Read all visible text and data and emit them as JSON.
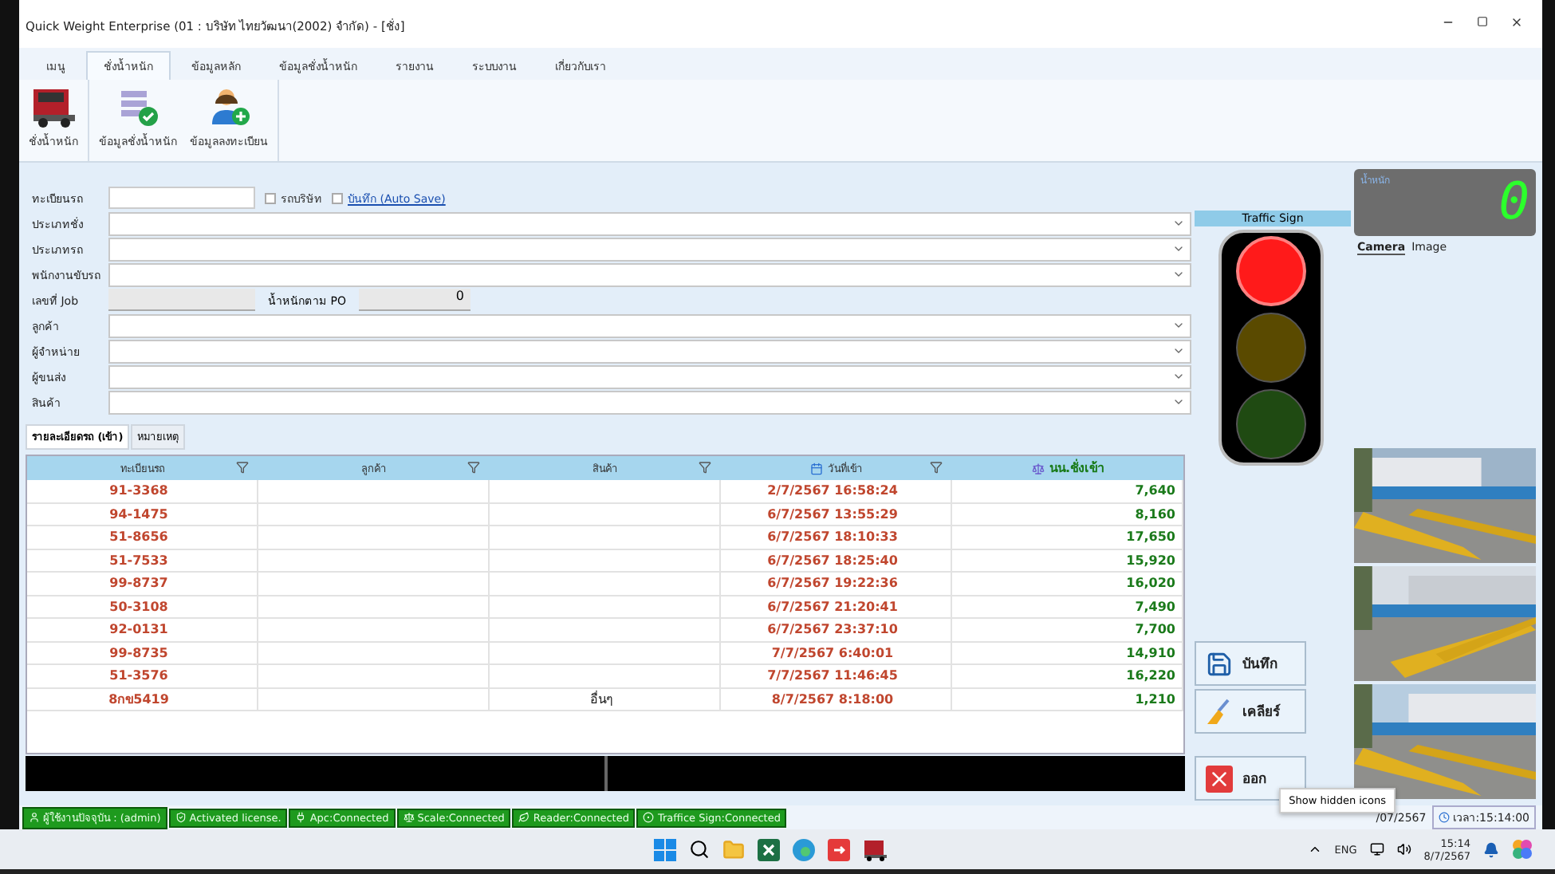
{
  "window": {
    "title": "Quick Weight Enterprise (01 : บริษัท ไทยวัฒนา(2002) จำกัด) - [ชั่ง]"
  },
  "menu_tabs": [
    {
      "label": "เมนู",
      "selected": false
    },
    {
      "label": "ชั่งน้ำหนัก",
      "selected": true
    },
    {
      "label": "ข้อมูลหลัก",
      "selected": false
    },
    {
      "label": "ข้อมูลชั่งน้ำหนัก",
      "selected": false
    },
    {
      "label": "รายงาน",
      "selected": false
    },
    {
      "label": "ระบบงาน",
      "selected": false
    },
    {
      "label": "เกี่ยวกับเรา",
      "selected": false
    }
  ],
  "ribbon": [
    {
      "label": "ชั่งน้ำหนัก",
      "kind": "truck"
    },
    {
      "label": "ข้อมูลชั่งน้ำหนัก",
      "kind": "list"
    },
    {
      "label": "ข้อมูลลงทะเบียน",
      "kind": "person"
    }
  ],
  "plate": {
    "label": "ทะเบียนรถ",
    "checkboxes": [
      {
        "label": "รถบริษัท",
        "checked": false,
        "kind": "plain"
      },
      {
        "label": "บันทึก (Auto Save)",
        "checked": false,
        "kind": "link"
      }
    ]
  },
  "fields": [
    {
      "label": "ประเภทชั่ง",
      "kind": "combo"
    },
    {
      "label": "ประเภทรถ",
      "kind": "combo"
    },
    {
      "label": "พนักงานขับรถ",
      "kind": "combo"
    },
    {
      "label": "เลขที่ Job",
      "kind": "job",
      "po_label": "น้ำหนักตาม PO",
      "po_value": "0"
    },
    {
      "label": "ลูกค้า",
      "kind": "combo"
    },
    {
      "label": "ผู้จำหน่าย",
      "kind": "combo"
    },
    {
      "label": "ผู้ขนส่ง",
      "kind": "combo"
    },
    {
      "label": "สินค้า",
      "kind": "combo"
    }
  ],
  "detail_tabs": [
    {
      "label": "รายละเอียดรถ (เข้า)",
      "selected": true
    },
    {
      "label": "หมายเหตุ",
      "selected": false
    }
  ],
  "table": {
    "columns": [
      {
        "label": "ทะเบียนรถ",
        "kind": "text",
        "filter": true
      },
      {
        "label": "ลูกค้า",
        "kind": "text",
        "filter": true
      },
      {
        "label": "สินค้า",
        "kind": "text",
        "filter": true
      },
      {
        "label": "วันที่เข้า",
        "kind": "date",
        "filter": true
      },
      {
        "label": "นน.ชั่งเข้า",
        "kind": "weight"
      }
    ],
    "rows": [
      [
        "91-3368",
        "",
        "",
        "2/7/2567 16:58:24",
        "7,640"
      ],
      [
        "94-1475",
        "",
        "",
        "6/7/2567 13:55:29",
        "8,160"
      ],
      [
        "51-8656",
        "",
        "",
        "6/7/2567 18:10:33",
        "17,650"
      ],
      [
        "51-7533",
        "",
        "",
        "6/7/2567 18:25:40",
        "15,920"
      ],
      [
        "99-8737",
        "",
        "",
        "6/7/2567 19:22:36",
        "16,020"
      ],
      [
        "50-3108",
        "",
        "",
        "6/7/2567 21:20:41",
        "7,490"
      ],
      [
        "92-0131",
        "",
        "",
        "6/7/2567 23:37:10",
        "7,700"
      ],
      [
        "99-8735",
        "",
        "",
        "7/7/2567 6:40:01",
        "14,910"
      ],
      [
        "51-3576",
        "",
        "",
        "7/7/2567 11:46:45",
        "16,220"
      ],
      [
        "8กข5419",
        "",
        "อื่นๆ",
        "8/7/2567 8:18:00",
        "1,210"
      ]
    ]
  },
  "traffic_sign": {
    "title": "Traffic Sign",
    "lights": [
      {
        "color": "#ff1a1a",
        "on": true
      },
      {
        "color": "#5a4a00",
        "on": false
      },
      {
        "color": "#1f4a12",
        "on": false
      }
    ]
  },
  "scale": {
    "label": "น้ำหนัก",
    "reading": "0"
  },
  "camera_tabs": [
    {
      "label": "Camera",
      "selected": true
    },
    {
      "label": "Image",
      "selected": false
    }
  ],
  "actions": [
    {
      "label": "บันทึก",
      "kind": "save"
    },
    {
      "label": "เคลียร์",
      "kind": "clear"
    },
    {
      "label": "ออก",
      "kind": "exit"
    }
  ],
  "status_bar": {
    "items": [
      {
        "label": "ผู้ใช้งานปัจจุบัน : (admin)",
        "kind": "user"
      },
      {
        "label": "Activated license.",
        "kind": "license"
      },
      {
        "label": "Apc:Connected",
        "kind": "apc"
      },
      {
        "label": "Scale:Connected",
        "kind": "scale"
      },
      {
        "label": "Reader:Connected",
        "kind": "reader"
      },
      {
        "label": "Traffice Sign:Connected",
        "kind": "traffic"
      }
    ],
    "date": "/07/2567",
    "time": "เวลา:15:14:00"
  },
  "tooltip": "Show hidden icons",
  "taskbar": {
    "language": "ENG",
    "time": "15:14",
    "date": "8/7/2567"
  }
}
